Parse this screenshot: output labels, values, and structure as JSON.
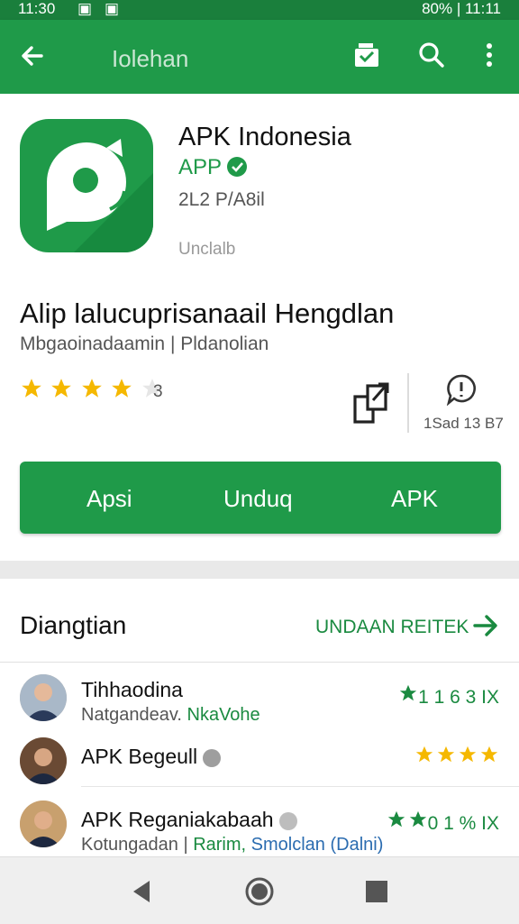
{
  "status_bar": {
    "time": "11:30",
    "right": "80% | 11:11"
  },
  "app_bar": {
    "title": "Iolehan"
  },
  "app": {
    "name": "APK Indonesia",
    "tag": "APP",
    "size": "2L2 P/A8il",
    "status": "Unclalb",
    "headline": "Alip lalucuprisanaail Hengdlan",
    "subline": "Mbgaoinadaamin | Pldanolian",
    "rating_count": "3",
    "comment_date": "1Sad 13 B7",
    "stars": 4
  },
  "install_bar": {
    "left": "Apsi",
    "center": "Unduq",
    "right": "APK"
  },
  "section": {
    "title": "Diangtian",
    "link": "UNDAAN REITEK"
  },
  "list": [
    {
      "title": "Tihhaodina",
      "sub_plain": "Natgandeav.",
      "sub_green": "NkaVohe",
      "rating_text": "1 1 6 3 IX"
    },
    {
      "title": "APK Begeull",
      "rating_stars": 4
    },
    {
      "title": "APK Reganiakabaah",
      "sub_plain": "Kotungadan |",
      "sub_green": "Rarim,",
      "sub_blue": "Smolclan (Dalni)",
      "rating_text": "0 1 % IX"
    }
  ],
  "colors": {
    "primary": "#1f9a49",
    "status": "#1a7f3c",
    "star": "#f5b800"
  }
}
